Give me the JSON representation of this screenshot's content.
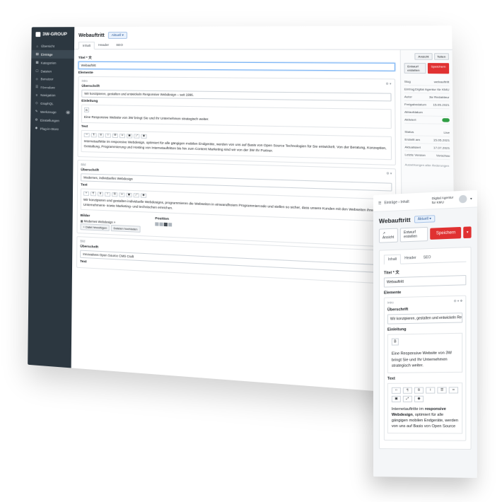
{
  "app": {
    "brand": "3W-GROUP"
  },
  "sidebar": {
    "items": [
      {
        "icon": "home-icon",
        "glyph": "⌂",
        "label": "Übersicht"
      },
      {
        "icon": "document-icon",
        "glyph": "▤",
        "label": "Einträge"
      },
      {
        "icon": "folder-icon",
        "glyph": "▦",
        "label": "Kategorien"
      },
      {
        "icon": "file-icon",
        "glyph": "▢",
        "label": "Dateien"
      },
      {
        "icon": "user-icon",
        "glyph": "☺",
        "label": "Benutzer"
      },
      {
        "icon": "form-icon",
        "glyph": "☰",
        "label": "Formulare"
      },
      {
        "icon": "nav-icon",
        "glyph": "≡",
        "label": "Navigation"
      },
      {
        "icon": "graphql-icon",
        "glyph": "◇",
        "label": "GraphQL"
      },
      {
        "icon": "wrench-icon",
        "glyph": "✎",
        "label": "Werkzeuge",
        "badge": "4"
      },
      {
        "icon": "gear-icon",
        "glyph": "⚙",
        "label": "Einstellungen"
      },
      {
        "icon": "plugin-icon",
        "glyph": "✱",
        "label": "Plug-in-Store"
      }
    ]
  },
  "entry": {
    "title": "Webauftritt",
    "language": "Aktuell",
    "tabs": [
      "Inhalt",
      "Header",
      "SEO"
    ],
    "title_label": "Titel",
    "title_value": "Webauftritt",
    "elements_label": "Elemente",
    "block_type": "Intro",
    "ueberschrift_label": "Überschrift",
    "ueberschrift_value": "Wir konzipieren, gestalten und entwickeln Responsive Webdesign – seit 1996.",
    "einleitung_label": "Einleitung",
    "heading_btn": "B",
    "einleitung_text": "Eine Responsive Website von 3W bringt Sie und Ihr Unternehmen strategisch weiter.",
    "text_label": "Text",
    "text_body": "Internetauftritte im responsive Webdesign, optimiert für alle gängigen mobilen Endgeräte, werden von uns auf Basis von Open Source Technologien für Sie entwickelt. Von der Beratung, Konzeption, Gestaltung, Programmierung und Hosting von Internetauftritten bis hin zum Content Marketing sind wir von der 3W Ihr Partner.",
    "block2_type": "Bild",
    "block2_ueberschrift": "Modernes, individuelles Webdesign",
    "block2_text": "Wir konzipieren und gestalten individuelle Webdesigns, programmieren die Webseiten in einwandfreiem Programmiercode und stellen so sicher, dass unsere Kunden mit den Webseiten ihre Unternehmens- sowie Marketing- und technischen erreichen.",
    "bilder_label": "Bilder",
    "bilder_value": "Modernes Webdesign",
    "position_label": "Position",
    "add_file": "+ Datei hinzufügen",
    "upload_file": "Dateien hochladen",
    "block3_type": "Bild",
    "block3_ueberschrift": "Innovatives Open Source CMS Craft",
    "toolbar": {
      "view": "Ansicht",
      "share": "Teilen",
      "draft": "Entwurf erstellen",
      "save": "Speichern"
    },
    "meta": [
      {
        "k": "Slug",
        "v": "webauftritt"
      },
      {
        "k": "Eintrag",
        "v": "Digital Agentur für KMU"
      },
      {
        "k": "Autor",
        "v": "3w Redakteur"
      },
      {
        "k": "Freigabedatum",
        "v": "15.05.2021"
      },
      {
        "k": "Ablaufdatum",
        "v": ""
      },
      {
        "k": "Aktiviert",
        "v": ""
      }
    ],
    "status": [
      {
        "k": "Status",
        "v": "Live"
      },
      {
        "k": "Erstellt am",
        "v": "15.05.2021"
      },
      {
        "k": "Aktualisiert",
        "v": "17.07.2021"
      },
      {
        "k": "Letzte Version",
        "v": "Vorschau"
      }
    ],
    "right_note": "Auswirkungen aller Änderungen"
  },
  "mobile": {
    "breadcrumb": "Einträge",
    "current": "Inhalt",
    "agency": "Digital Agentur für KMU",
    "title": "Webauftritt",
    "language": "Aktuell",
    "view": "Ansicht",
    "draft": "Entwurf erstellen",
    "save": "Speichern",
    "tabs": [
      "Inhalt",
      "Header",
      "SEO"
    ],
    "title_label": "Titel",
    "title_value": "Webauftritt",
    "elements_label": "Elemente",
    "block_type": "Intro",
    "ueberschrift_label": "Überschrift",
    "ueberschrift_value": "Wir konzipieren, gestalten und entwickeln Res",
    "einleitung_label": "Einleitung",
    "heading_btn": "B",
    "einleitung_text": "Eine Responsive Website von 3W bringt Sie und Ihr Unternehmen strategisch weiter.",
    "text_label": "Text",
    "text_body_prefix": "Internetauftritte im ",
    "text_body_bold": "responsive Webdesign",
    "text_body_suffix": ", optimiert für alle gängigen mobilen Endgeräte, werden von uns auf Basis von Open Source"
  },
  "colors": {
    "sidebar": "#2c3740",
    "accent": "#e03131",
    "lang_badge": "#e8f1fc"
  }
}
